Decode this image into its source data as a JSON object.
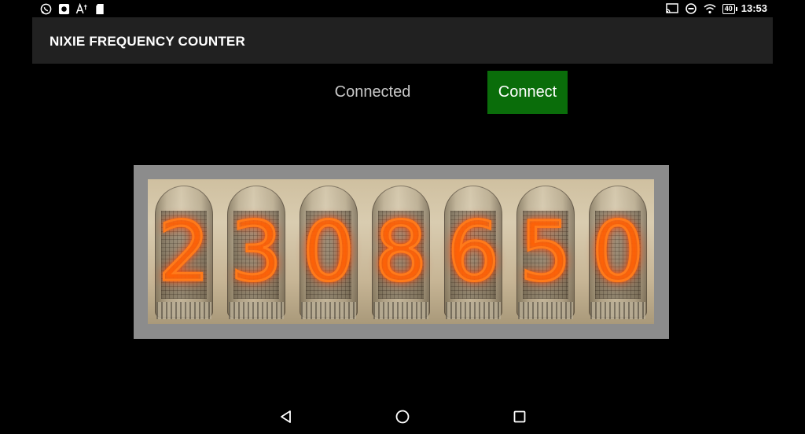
{
  "status_bar": {
    "time": "13:53",
    "battery": "40",
    "left_icons": [
      "whatsapp-icon",
      "camera-icon",
      "font-icon",
      "sd-card-icon"
    ],
    "right_icons": [
      "cast-icon",
      "do-not-disturb-icon",
      "wifi-icon",
      "battery-icon"
    ]
  },
  "app_bar": {
    "title": "NIXIE FREQUENCY COUNTER"
  },
  "connection": {
    "status": "Connected",
    "button_label": "Connect",
    "button_color": "#0a6d0a"
  },
  "display": {
    "digits": [
      "2",
      "3",
      "0",
      "8",
      "6",
      "5",
      "0"
    ],
    "glow_color": "#ff7a1a"
  },
  "nav_bar": {
    "buttons": [
      "back-icon",
      "home-icon",
      "recents-icon"
    ]
  }
}
